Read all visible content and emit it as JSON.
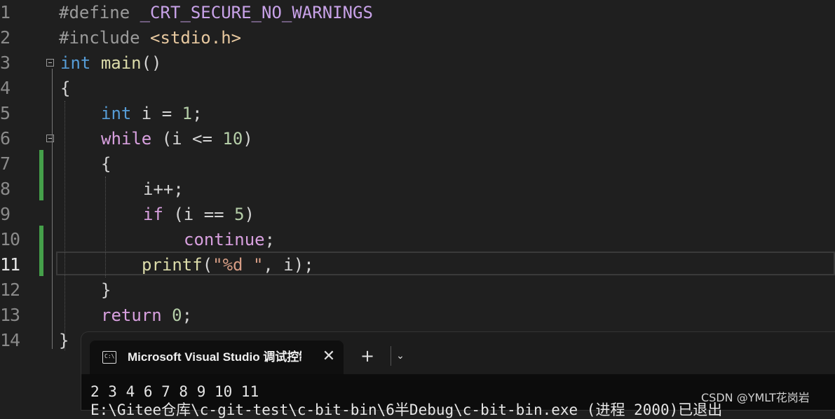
{
  "editor": {
    "lines": [
      {
        "n": "1"
      },
      {
        "n": "2"
      },
      {
        "n": "3"
      },
      {
        "n": "4"
      },
      {
        "n": "5"
      },
      {
        "n": "6"
      },
      {
        "n": "7"
      },
      {
        "n": "8"
      },
      {
        "n": "9"
      },
      {
        "n": "10"
      },
      {
        "n": "11"
      },
      {
        "n": "12"
      },
      {
        "n": "13"
      },
      {
        "n": "14"
      }
    ],
    "code": {
      "l1_directive": "#define",
      "l1_macro": "_CRT_SECURE_NO_WARNINGS",
      "l2_directive": "#include",
      "l2_header": "<stdio.h>",
      "l3_type": "int",
      "l3_name": "main",
      "l3_rest": "()",
      "l4": "{",
      "l5_type": "int",
      "l5_mid": " i = ",
      "l5_num": "1",
      "l5_end": ";",
      "l6_kw": "while",
      "l6_mid": " (i <= ",
      "l6_num": "10",
      "l6_end": ")",
      "l7": "{",
      "l8": "i++;",
      "l9_kw": "if",
      "l9_mid": " (i == ",
      "l9_num": "5",
      "l9_end": ")",
      "l10_kw": "continue",
      "l10_end": ";",
      "l11_fn": "printf",
      "l11_open": "(",
      "l11_str": "\"%d \"",
      "l11_end": ", i);",
      "l12": "}",
      "l13_kw": "return",
      "l13_sp": " ",
      "l13_num": "0",
      "l13_end": ";",
      "l14": "}"
    }
  },
  "console": {
    "tab_title": "Microsoft Visual Studio 调试控制台",
    "tab_icon_text": "C:\\",
    "close_icon": "✕",
    "new_tab_icon": "+",
    "dropdown_icon": "⌄",
    "output_line1": "2 3 4 6 7 8 9 10 11",
    "output_line2": "E:\\Gitee仓库\\c-git-test\\c-bit-bin\\6半Debug\\c-bit-bin.exe (进程 2000)已退出"
  },
  "watermark": "CSDN @YMLT花岗岩",
  "colors": {
    "background": "#1f1f1f",
    "keyword": "#569cd6",
    "control": "#d8a0df",
    "function": "#dcdcaa",
    "number": "#b5cea8",
    "string": "#d69d85",
    "change_bar": "#45a04a"
  }
}
